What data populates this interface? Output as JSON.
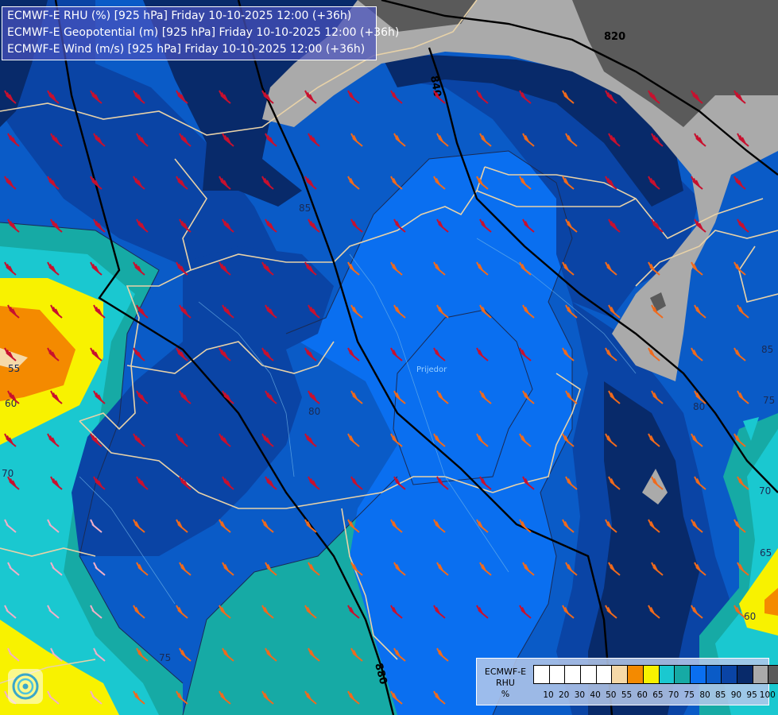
{
  "title": {
    "line1": "ECMWF-E RHU (%) [925 hPa] Friday 10-10-2025 12:00 (+36h)",
    "line2": "ECMWF-E Geopotential (m) [925 hPa] Friday 10-10-2025 12:00 (+36h)",
    "line3": "ECMWF-E Wind (m/s) [925 hPa] Friday 10-10-2025 12:00 (+36h)"
  },
  "legend": {
    "model": "ECMWF-E",
    "variable": "RHU",
    "unit": "%",
    "colors": [
      "#ffffff",
      "#ffffff",
      "#ffffff",
      "#ffffff",
      "#ffffff",
      "#f6d9a8",
      "#f48a00",
      "#f8f200",
      "#1ac8d0",
      "#16aaa5",
      "#0a6ff0",
      "#0a5bc7",
      "#0a44a5",
      "#082a6a",
      "#aaaaaa",
      "#5a5a5a"
    ],
    "ticks": [
      "10",
      "20",
      "30",
      "40",
      "50",
      "55",
      "60",
      "65",
      "70",
      "75",
      "80",
      "85",
      "90",
      "95",
      "100"
    ]
  },
  "contour_labels": {
    "rh_55": "55",
    "rh_60_left": "60",
    "rh_70_left": "70",
    "rh_75_bottom": "75",
    "rh_80_center": "80",
    "rh_85_top": "85",
    "rh_85_right": "85",
    "rh_75_right": "75",
    "rh_70_right": "70",
    "rh_65_right": "65",
    "rh_60_right": "60",
    "rh_80_right": "80"
  },
  "geopotential_labels": {
    "g820": "820",
    "g840": "840",
    "g880": "880"
  },
  "map_place_label": "Prijedor",
  "colors": {
    "rh_95": "#aaaaaa",
    "rh_100": "#5a5a5a",
    "rh_90": "#082a6a",
    "rh_85": "#0a44a5",
    "rh_80": "#0a5bc7",
    "rh_75": "#0a6ff0",
    "rh_70": "#16aaa5",
    "rh_65": "#1ac8d0",
    "rh_60": "#f8f200",
    "rh_55": "#f48a00",
    "rh_50": "#f6d9a8",
    "border": "#e8d2a8",
    "wind_red": "#c8102e",
    "wind_orange": "#f06a1c",
    "wind_pink": "#f3b0c8"
  }
}
